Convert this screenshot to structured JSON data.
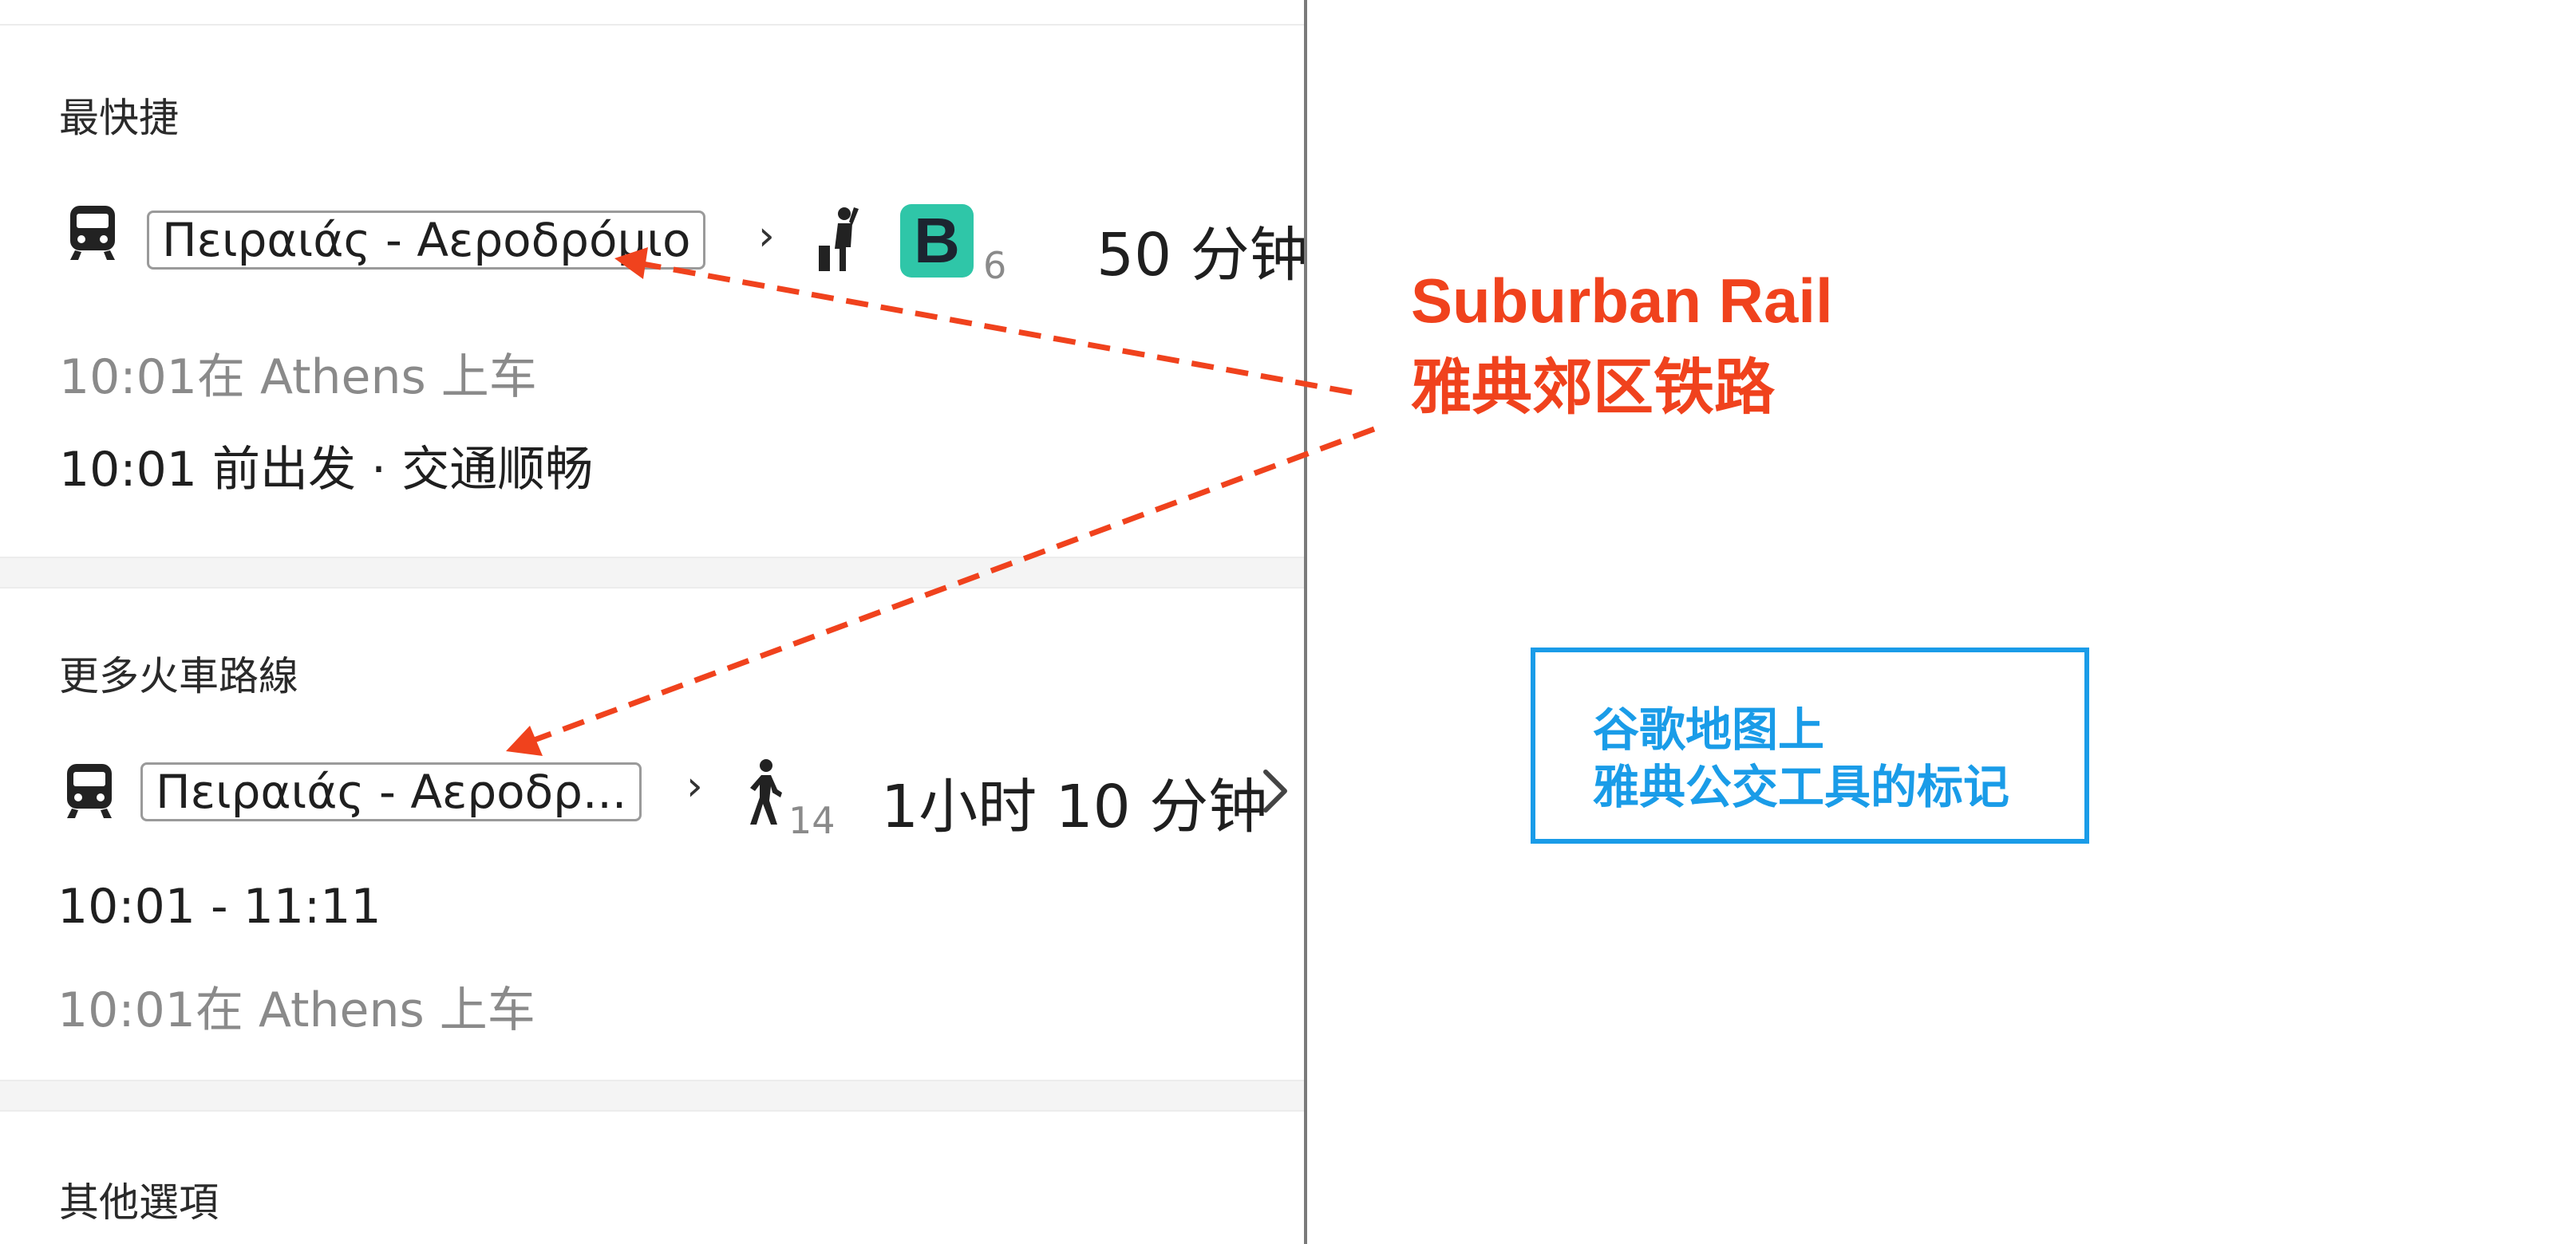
{
  "fastest": {
    "section_title": "最快捷",
    "route_name": "Πειραιάς - Αεροδρόμιο",
    "transfer_count": "6",
    "duration": "50 分钟",
    "boarding": "10:01在 Athens 上车",
    "departure_status": "10:01 前出发 · 交通顺畅"
  },
  "more_trains": {
    "section_title": "更多火車路線",
    "route_name": "Πειραιάς - Αεροδρ...",
    "walk_minutes": "14",
    "duration": "1小时 10 分钟",
    "time_range": "10:01 - 11:11",
    "boarding": "10:01在 Athens 上车"
  },
  "other": {
    "section_title": "其他選項"
  },
  "annotations": {
    "rail_en": "Suburban Rail",
    "rail_cn": "雅典郊区铁路",
    "note_line1": "谷歌地图上",
    "note_line2": "雅典公交工具的标记",
    "colors": {
      "red": "#f0421d",
      "blue": "#1a9ce8",
      "badge": "#2fc6a8"
    }
  }
}
